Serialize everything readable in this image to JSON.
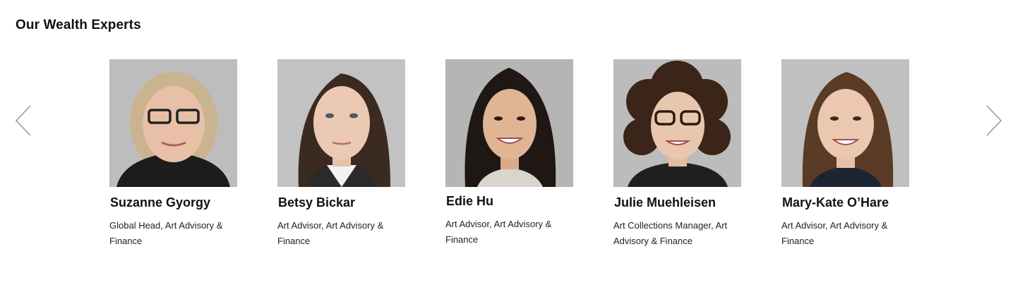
{
  "section": {
    "title": "Our Wealth Experts"
  },
  "carousel": {
    "prev_icon": "chevron-left-icon",
    "next_icon": "chevron-right-icon",
    "arrow_color": "#9a9a9a"
  },
  "experts": [
    {
      "name": "Suzanne Gyorgy",
      "role": "Global Head, Art Advisory & Finance",
      "hair": "#c9b48f",
      "bg": "#bdbdbd",
      "top": "#1c1c1c"
    },
    {
      "name": "Betsy Bickar",
      "role": "Art Advisor, Art Advisory & Finance",
      "hair": "#3b2a20",
      "bg": "#c2c2c2",
      "top": "#2a2a2a"
    },
    {
      "name": "Edie Hu",
      "role": "Art Advisor, Art Advisory & Finance",
      "hair": "#1e1714",
      "bg": "#b5b5b5",
      "top": "#d9d4cc"
    },
    {
      "name": "Julie Muehleisen",
      "role": "Art Collections Manager, Art Advisory & Finance",
      "hair": "#3a2518",
      "bg": "#bcbcbc",
      "top": "#1f1f1f"
    },
    {
      "name": "Mary-Kate O’Hare",
      "role": "Art Advisor, Art Advisory & Finance",
      "hair": "#5a3b26",
      "bg": "#c0c0c0",
      "top": "#1d2433"
    }
  ]
}
